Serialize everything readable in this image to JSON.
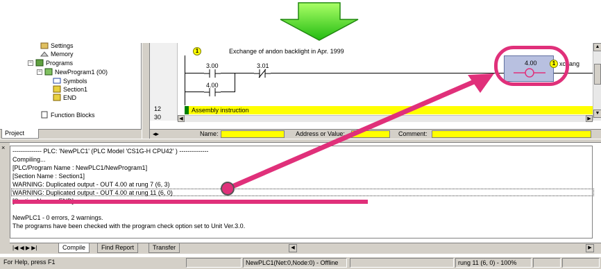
{
  "project_tree": {
    "items": [
      {
        "label": "Settings",
        "icon": "settings-icon"
      },
      {
        "label": "Memory",
        "icon": "memory-icon"
      },
      {
        "label": "Programs",
        "icon": "programs-icon"
      },
      {
        "label": "NewProgram1 (00)",
        "icon": "program-icon"
      },
      {
        "label": "Symbols",
        "icon": "symbols-icon"
      },
      {
        "label": "Section1",
        "icon": "section-icon"
      },
      {
        "label": "END",
        "icon": "end-section-icon"
      },
      {
        "label": "Function Blocks",
        "icon": "function-blocks-icon"
      }
    ],
    "tab_label": "Project"
  },
  "ladder": {
    "rung_numbers": [
      "12",
      "30"
    ],
    "comment": "Exchange of andon backlight in Apr. 1999",
    "contact_1": "3.00",
    "contact_2": "3.01",
    "contact_3": "4.00",
    "coil_address": "4.00",
    "coil_trailing_text": "xchang",
    "badge": "1",
    "assembly_instruction": "Assembly instruction"
  },
  "name_bar": {
    "name_label": "Name:",
    "address_label": "Address or Value:",
    "comment_label": "Comment:"
  },
  "output": {
    "lines": [
      "-------------- PLC: 'NewPLC1' (PLC Model 'CS1G-H CPU42' ) --------------",
      "Compiling...",
      "[PLC/Program Name : NewPLC1/NewProgram1]",
      "[Section Name : Section1]",
      "WARNING: Duplicated output - OUT 4.00 at rung 7 (6, 3)",
      "WARNING: Duplicated output - OUT 4.00 at rung 11 (6, 0)",
      "[Section Name : END]",
      "",
      "NewPLC1 - 0 errors, 2 warnings.",
      "The programs have been checked with the program check option set to Unit Ver.3.0."
    ],
    "tabs": [
      "Compile",
      "Find Report",
      "Transfer"
    ]
  },
  "status_bar": {
    "help": "For Help, press F1",
    "plc_status": "NewPLC1(Net:0,Node:0) - Offline",
    "position": "rung 11 (6, 0) - 100%"
  },
  "colors": {
    "arrow_green": "#33dd22",
    "highlight_pink": "#e0307a",
    "field_yellow": "#ffff00"
  }
}
